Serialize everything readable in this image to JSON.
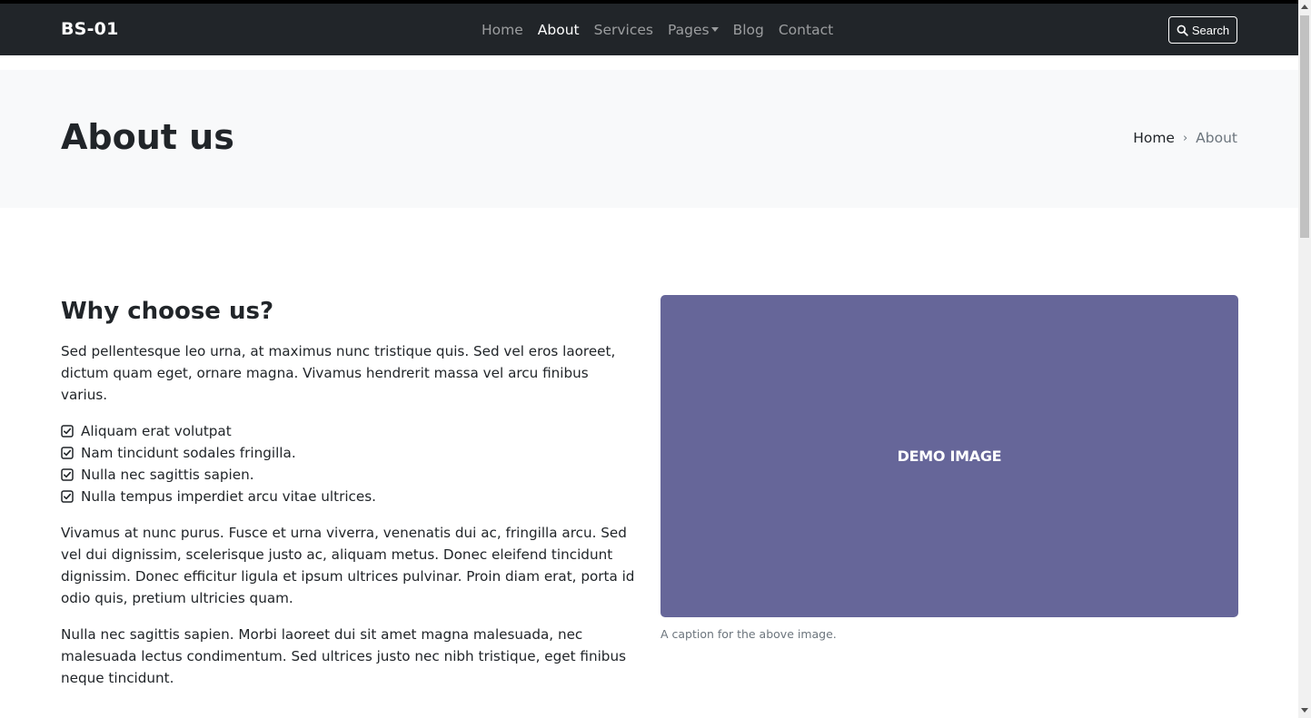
{
  "navbar": {
    "brand": "BS-01",
    "links": [
      {
        "label": "Home"
      },
      {
        "label": "About"
      },
      {
        "label": "Services"
      },
      {
        "label": "Pages"
      },
      {
        "label": "Blog"
      },
      {
        "label": "Contact"
      }
    ],
    "search_label": "Search"
  },
  "hero": {
    "title": "About us",
    "breadcrumb": {
      "home": "Home",
      "separator": "›",
      "current": "About"
    }
  },
  "main": {
    "heading": "Why choose us?",
    "intro": "Sed pellentesque leo urna, at maximus nunc tristique quis. Sed vel eros laoreet, dictum quam eget, ornare magna. Vivamus hendrerit massa vel arcu finibus varius.",
    "checklist": [
      "Aliquam erat volutpat",
      "Nam tincidunt sodales fringilla.",
      "Nulla nec sagittis sapien.",
      "Nulla tempus imperdiet arcu vitae ultrices."
    ],
    "paragraph2": "Vivamus at nunc purus. Fusce et urna viverra, venenatis dui ac, fringilla arcu. Sed vel dui dignissim, scelerisque justo ac, aliquam metus. Donec eleifend tincidunt dignissim. Donec efficitur ligula et ipsum ultrices pulvinar. Proin diam erat, porta id odio quis, pretium ultricies quam.",
    "paragraph3": "Nulla nec sagittis sapien. Morbi laoreet dui sit amet magna malesuada, nec malesuada lectus condimentum. Sed ultrices justo nec nibh tristique, eget finibus neque tincidunt."
  },
  "figure": {
    "image_text": "DEMO IMAGE",
    "image_color": "#666699",
    "caption": "A caption for the above image."
  },
  "colors": {
    "navbar_bg": "#212529",
    "hero_bg": "#f8f9fa"
  }
}
